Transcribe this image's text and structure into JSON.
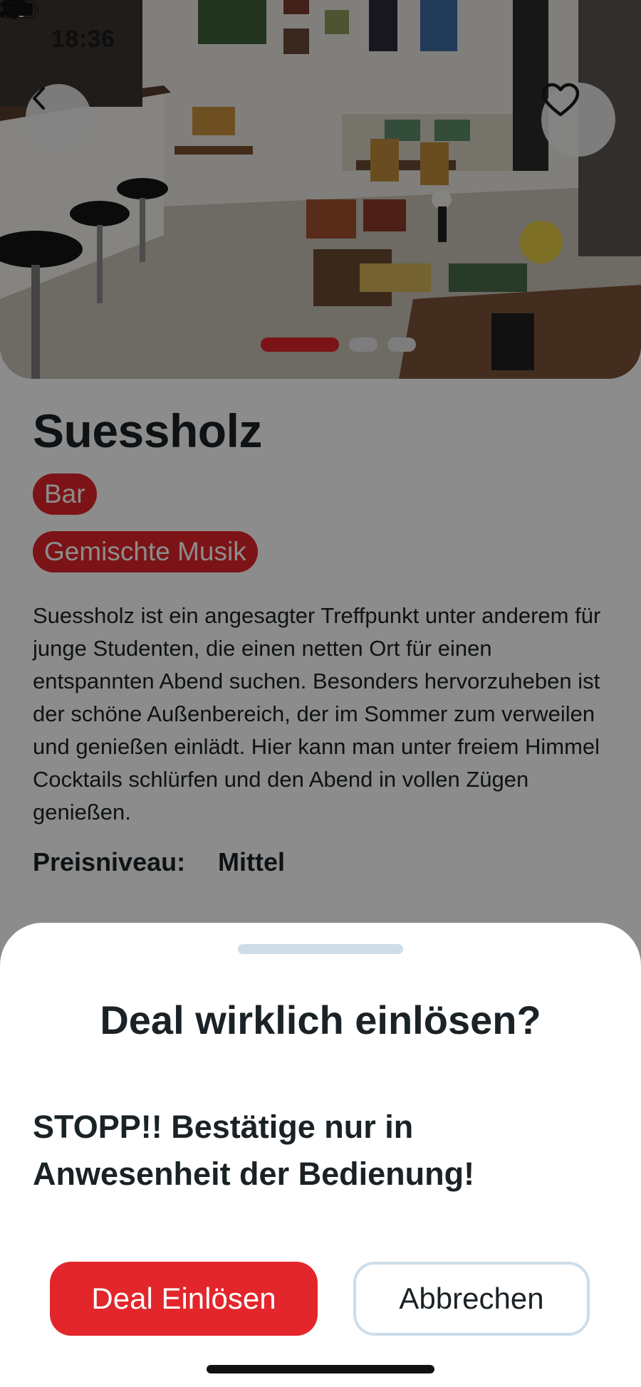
{
  "status_bar": {
    "time": "18:36",
    "icons": [
      "signal-icon",
      "wifi-icon",
      "battery-icon"
    ]
  },
  "hero": {
    "carousel": {
      "count": 3,
      "active_index": 0
    },
    "back_icon": "chevron-left-icon",
    "favorite_icon": "heart-icon"
  },
  "venue": {
    "name": "Suessholz",
    "tags": [
      "Bar",
      "Gemischte Musik"
    ],
    "description": "Suessholz ist ein angesagter Treffpunkt unter anderem für junge Studenten, die einen netten Ort für einen entspannten Abend suchen. Besonders hervorzuheben ist der schöne Außenbereich, der im Sommer zum verweilen und genießen einlädt. Hier kann man unter freiem Himmel Cocktails schlürfen und den Abend in vollen Zügen genießen.",
    "price_label": "Preisniveau:",
    "price_value": "Mittel"
  },
  "sheet": {
    "title": "Deal wirklich einlösen?",
    "warning": "STOPP!! Bestätige nur in Anwesenheit der Bedienung!",
    "confirm_label": "Deal Einlösen",
    "cancel_label": "Abbrechen"
  },
  "colors": {
    "accent": "#e2262b",
    "text": "#1b2226",
    "handle": "#cddde9"
  }
}
